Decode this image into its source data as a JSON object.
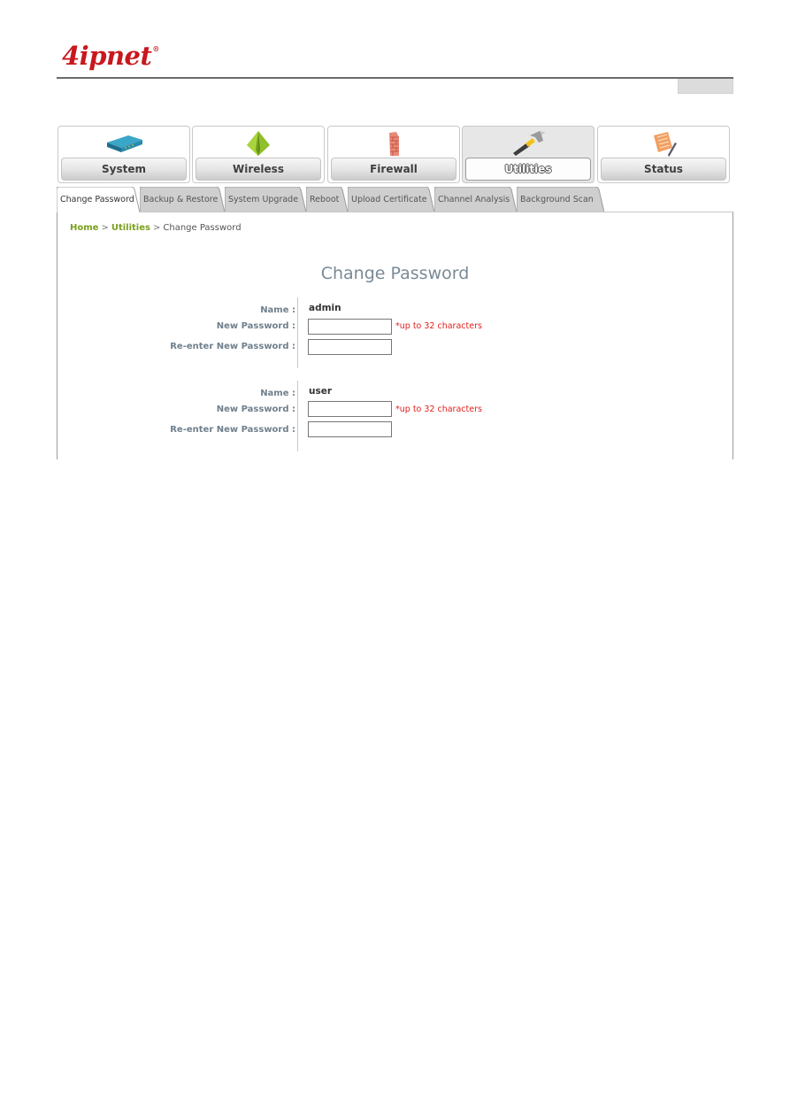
{
  "brand": {
    "logo_text": "4ipnet",
    "registered_mark": "®",
    "color": "#c8181e"
  },
  "nav": {
    "items": [
      {
        "label": "System",
        "icon": "router-icon",
        "active": false
      },
      {
        "label": "Wireless",
        "icon": "wireless-pyramid-icon",
        "active": false
      },
      {
        "label": "Firewall",
        "icon": "firewall-brick-icon",
        "active": false
      },
      {
        "label": "Utilities",
        "icon": "hammer-icon",
        "active": true
      },
      {
        "label": "Status",
        "icon": "notepad-icon",
        "active": false
      }
    ]
  },
  "tabs": [
    {
      "label": "Change Password",
      "active": true
    },
    {
      "label": "Backup & Restore",
      "active": false
    },
    {
      "label": "System Upgrade",
      "active": false
    },
    {
      "label": "Reboot",
      "active": false
    },
    {
      "label": "Upload Certificate",
      "active": false
    },
    {
      "label": "Channel Analysis",
      "active": false
    },
    {
      "label": "Background Scan",
      "active": false
    }
  ],
  "breadcrumb": {
    "home": "Home",
    "section": "Utilities",
    "current": "Change Password",
    "separator": ">"
  },
  "page": {
    "title": "Change Password",
    "accounts": [
      {
        "name_label": "Name :",
        "name_value": "admin",
        "new_password_label": "New Password :",
        "new_password_value": "",
        "hint": "*up to 32 characters",
        "reenter_label": "Re-enter New Password :",
        "reenter_value": ""
      },
      {
        "name_label": "Name :",
        "name_value": "user",
        "new_password_label": "New Password :",
        "new_password_value": "",
        "hint": "*up to 32 characters",
        "reenter_label": "Re-enter New Password :",
        "reenter_value": ""
      }
    ]
  },
  "colors": {
    "breadcrumb_link": "#7aa01c",
    "label": "#6f7f8c",
    "hint": "#e0201c",
    "title": "#7a8a96"
  }
}
